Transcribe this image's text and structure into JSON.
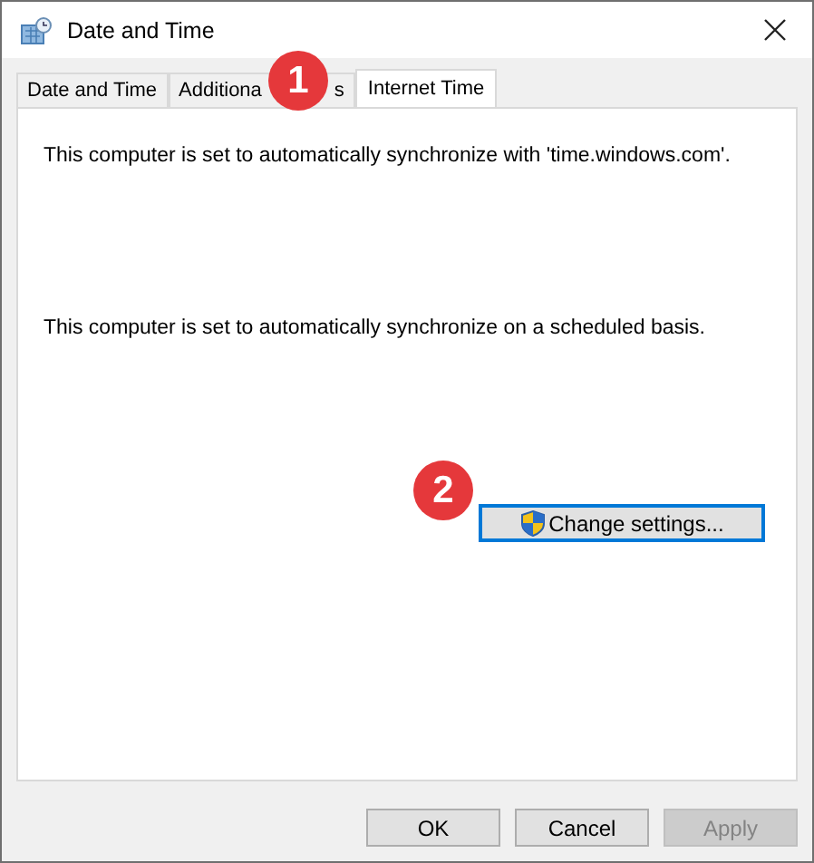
{
  "window": {
    "title": "Date and Time"
  },
  "tabs": [
    {
      "label": "Date and Time",
      "selected": false
    },
    {
      "label": "Additiona",
      "label_tail": "s",
      "selected": false
    },
    {
      "label": "Internet Time",
      "selected": true
    }
  ],
  "messages": [
    "This computer is set to automatically synchronize with 'time.windows.com'.",
    "This computer is set to automatically synchronize on a scheduled basis."
  ],
  "change_button": {
    "label": "Change settings...",
    "focused": true
  },
  "buttons": [
    {
      "label": "OK",
      "disabled": false
    },
    {
      "label": "Cancel",
      "disabled": false
    },
    {
      "label": "Apply",
      "disabled": true
    }
  ],
  "callouts": [
    "1",
    "2"
  ]
}
